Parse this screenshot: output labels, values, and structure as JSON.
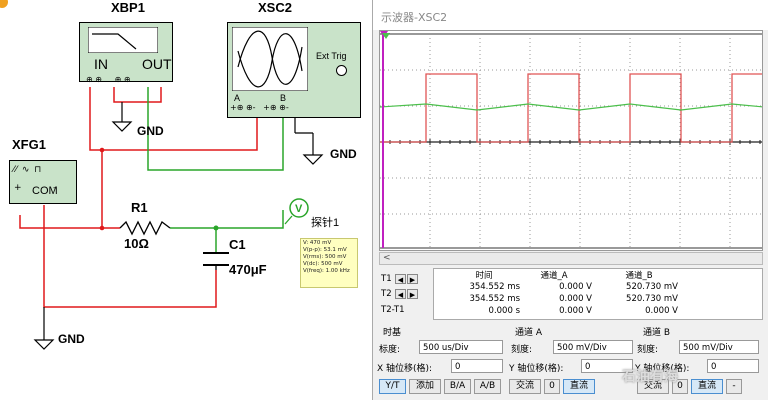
{
  "schematic": {
    "xbp1": {
      "name": "XBP1",
      "in_label": "IN",
      "out_label": "OUT"
    },
    "xsc2": {
      "name": "XSC2",
      "ext_trig": "Ext Trig",
      "a_label": "A",
      "b_label": "B"
    },
    "xfg1": {
      "name": "XFG1",
      "com_label": "COM"
    },
    "r1": {
      "name": "R1",
      "value": "10Ω"
    },
    "c1": {
      "name": "C1",
      "value": "470μF"
    },
    "gnd_labels": [
      "GND",
      "GND",
      "GND"
    ],
    "probe": {
      "name": "探针1",
      "readings": [
        "V: 470 mV",
        "V(p-p): 53.1 mV",
        "V(rms): 500 mV",
        "V(dc): 500 mV",
        "V(freq): 1.00 kHz"
      ]
    }
  },
  "scope": {
    "title": "示波器-XSC2",
    "scroll_left": "<",
    "cursor_rows": {
      "t1": "T1",
      "t2": "T2",
      "t2t1": "T2-T1"
    },
    "columns": {
      "time": "时间",
      "channel_a": "通道_A",
      "channel_b": "通道_B"
    },
    "rows": [
      {
        "time": "354.552 ms",
        "a": "0.000 V",
        "b": "520.730 mV"
      },
      {
        "time": "354.552 ms",
        "a": "0.000 V",
        "b": "520.730 mV"
      },
      {
        "time": "0.000 s",
        "a": "0.000 V",
        "b": "0.000 V"
      }
    ],
    "timebase": {
      "title": "时基",
      "scale_label": "标度:",
      "scale_value": "500 us/Div",
      "xpos_label": "X 轴位移(格):",
      "xpos_value": "0"
    },
    "channel_a": {
      "title": "通道 A",
      "scale_label": "刻度:",
      "scale_value": "500 mV/Div",
      "ypos_label": "Y 轴位移(格):",
      "ypos_value": "0"
    },
    "channel_b": {
      "title": "通道 B",
      "scale_label": "刻度:",
      "scale_value": "500 mV/Div",
      "ypos_label": "Y 轴位移(格):",
      "ypos_value": "0"
    },
    "buttons": {
      "yt": "Y/T",
      "add": "添加",
      "ba": "B/A",
      "ab": "A/B",
      "ac_a": "交流",
      "zero_a": "0",
      "dc_a": "直流",
      "ac_b": "交流",
      "zero_b": "0",
      "dc_b": "直流",
      "minus": "-"
    },
    "watermark": "石油有海"
  },
  "colors": {
    "wire_red": "#e0191b",
    "wire_green": "#2aa52a",
    "trace_a": "#4bbf4b",
    "trace_b": "#e05555",
    "instrument_bg": "#c9e3c9"
  }
}
